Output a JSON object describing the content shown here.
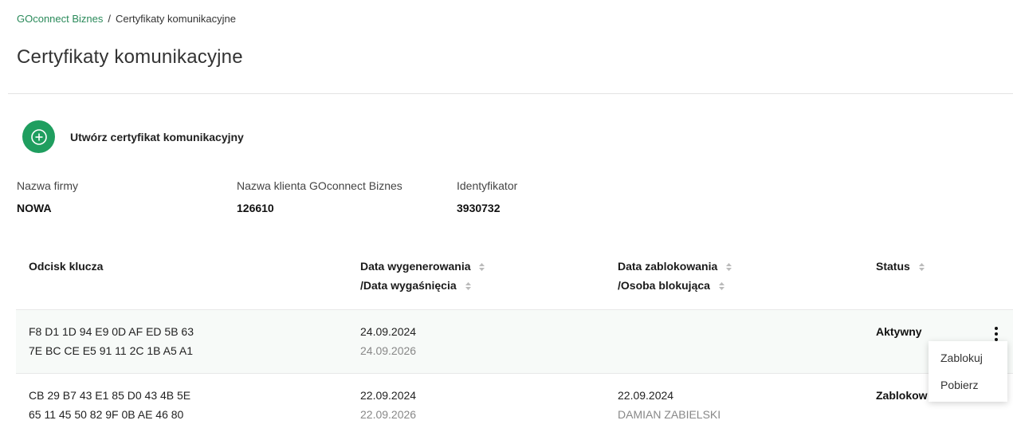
{
  "breadcrumb": {
    "root": "GOconnect Biznes",
    "separator": "/",
    "current": "Certyfikaty komunikacyjne"
  },
  "page_title": "Certyfikaty komunikacyjne",
  "create_button": {
    "label": "Utwórz certyfikat komunikacyjny",
    "icon": "plus-circle-icon",
    "color": "#1f9e5f"
  },
  "info": {
    "company": {
      "label": "Nazwa firmy",
      "value": "NOWA"
    },
    "client": {
      "label": "Nazwa klienta GOconnect Biznes",
      "value": "126610"
    },
    "identifier": {
      "label": "Identyfikator",
      "value": "3930732"
    }
  },
  "table": {
    "headers": {
      "fingerprint": "Odcisk klucza",
      "generated": "Data wygenerowania",
      "expires": "/Data wygaśnięcia",
      "blocked": "Data zablokowania",
      "blocked_by": "/Osoba blokująca",
      "status": "Status"
    },
    "rows": [
      {
        "fingerprint_1": "F8 D1 1D 94 E9 0D AF ED 5B 63",
        "fingerprint_2": "7E BC CE E5 91 11 2C 1B A5 A1",
        "generated": "24.09.2024",
        "expires": "24.09.2026",
        "blocked": "",
        "blocked_by": "",
        "status": "Aktywny"
      },
      {
        "fingerprint_1": "CB 29 B7 43 E1 85 D0 43 4B 5E",
        "fingerprint_2": "65 11 45 50 82 9F 0B AE 46 80",
        "generated": "22.09.2024",
        "expires": "22.09.2026",
        "blocked": "22.09.2024",
        "blocked_by": "DAMIAN ZABIELSKI",
        "status": "Zablokow"
      }
    ]
  },
  "context_menu": {
    "items": [
      "Zablokuj",
      "Pobierz"
    ]
  }
}
